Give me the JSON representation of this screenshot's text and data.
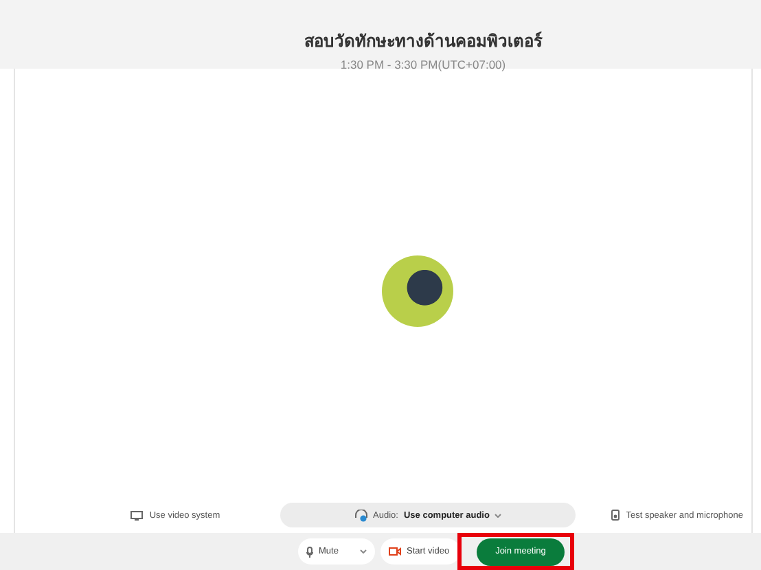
{
  "meeting": {
    "title": "สอบวัดทักษะทางด้านคอมพิวเตอร์",
    "time": "1:30 PM - 3:30 PM(UTC+07:00)"
  },
  "options": {
    "video_system": "Use video system",
    "audio_label": "Audio:",
    "audio_value": "Use computer audio",
    "test": "Test speaker and microphone"
  },
  "controls": {
    "mute": "Mute",
    "video": "Start video",
    "join": "Join meeting",
    "join_highlighted": true
  }
}
